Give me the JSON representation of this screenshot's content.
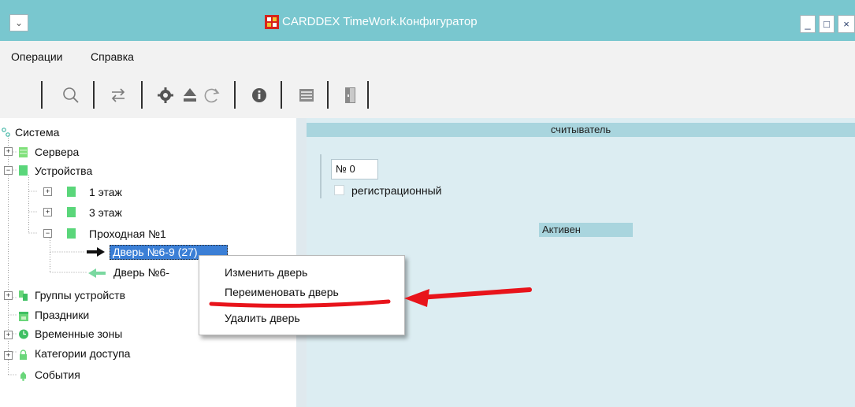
{
  "window": {
    "sysmenu_glyph": "⌄",
    "title": "CARDDEX TimeWork.Конфигуратор",
    "minimize_glyph": "_",
    "maximize_glyph": "□",
    "close_glyph": "×",
    "accent_color": "#79c7cf"
  },
  "menu": {
    "items": [
      {
        "label": "Операции"
      },
      {
        "label": "Справка"
      }
    ]
  },
  "toolbar": {
    "icons": [
      "search-icon",
      "exchange-icon",
      "gear-icon",
      "eject-icon",
      "refresh-icon",
      "info-icon",
      "panel-icon",
      "door-icon"
    ]
  },
  "tree": {
    "nodes": [
      {
        "label": "Система"
      },
      {
        "label": "Сервера"
      },
      {
        "label": "Устройства"
      },
      {
        "label": "1 этаж"
      },
      {
        "label": "3 этаж"
      },
      {
        "label": "Проходная №1"
      },
      {
        "label": "Дверь №6-9 (27)"
      },
      {
        "label": "Дверь №6-"
      },
      {
        "label": "Группы устройств"
      },
      {
        "label": "Праздники"
      },
      {
        "label": "Временные зоны"
      },
      {
        "label": "Категории доступа"
      },
      {
        "label": "События"
      }
    ]
  },
  "panel": {
    "header": "считыватель",
    "number": "№ 0",
    "checkbox_label": "регистрационный",
    "checkbox_checked": false,
    "status": "Активен"
  },
  "context_menu": {
    "items": [
      {
        "label": "Изменить дверь"
      },
      {
        "label": "Переименовать дверь"
      },
      {
        "label": "Удалить дверь"
      }
    ],
    "highlight_color": "#e8141b"
  }
}
